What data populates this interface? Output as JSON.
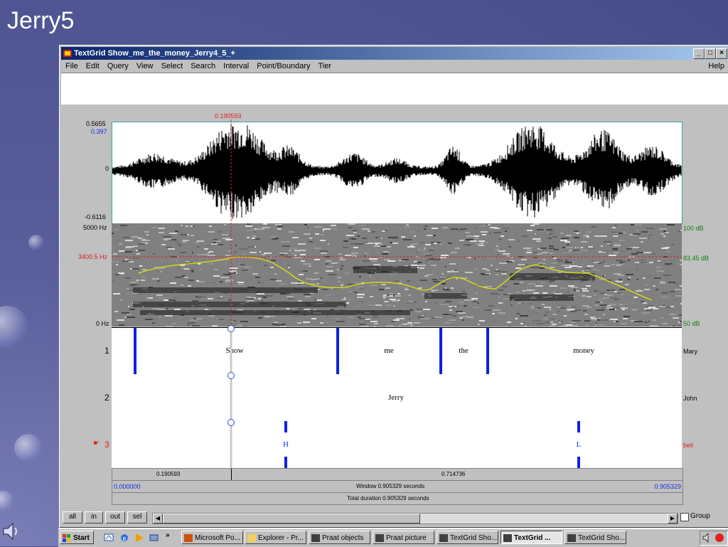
{
  "slide": {
    "title": "Jerry5"
  },
  "window": {
    "title": "TextGrid Show_me_the_money_Jerry4_5_+",
    "controls": {
      "minimize": "_",
      "maximize": "□",
      "close": "×"
    }
  },
  "menu": {
    "items": [
      "File",
      "Edit",
      "Query",
      "View",
      "Select",
      "Search",
      "Interval",
      "Point/Boundary",
      "Tier"
    ],
    "help": "Help"
  },
  "waveform": {
    "cursor_time": "0.190593",
    "y_max": "0.5655",
    "y_cursor": "0.397",
    "y_zero": "0",
    "y_min": "-0.6116"
  },
  "spectrogram": {
    "freq_max": "5000 Hz",
    "freq_cursor": "3400.5 Hz",
    "freq_min": "0 Hz",
    "db_max": "100 dB",
    "db_cursor": "83.45 dB",
    "db_min": "50 dB"
  },
  "tiers": [
    {
      "number": "1",
      "name": "Mary",
      "intervals": [
        "Show",
        "me",
        "the",
        "money"
      ]
    },
    {
      "number": "2",
      "name": "John",
      "intervals": [
        "Jerry"
      ]
    },
    {
      "number": "3",
      "name": "bell",
      "points": [
        "H",
        "L"
      ],
      "selected_marker": "☛"
    }
  ],
  "time_bars": {
    "left_segment": "0.190593",
    "right_segment": "0.714736",
    "start": "0.000000",
    "window": "Window 0.905329 seconds",
    "end": "0.905329",
    "total": "Total duration 0.905329 seconds"
  },
  "buttons": {
    "all": "all",
    "in": "in",
    "out": "out",
    "sel": "sel",
    "group": "Group"
  },
  "taskbar": {
    "start": "Start",
    "chevron": "»",
    "items": [
      {
        "label": "Microsoft Po...",
        "active": false
      },
      {
        "label": "Explorer - Pr...",
        "active": false
      },
      {
        "label": "Praat objects",
        "active": false
      },
      {
        "label": "Praat picture",
        "active": false
      },
      {
        "label": "TextGrid Sho...",
        "active": false
      },
      {
        "label": "TextGrid ...",
        "active": true
      },
      {
        "label": "TextGrid Sho...",
        "active": false
      }
    ]
  },
  "colors": {
    "boundary": "#1020e0",
    "cursor": "#e02020",
    "pitch": "#e8e800",
    "titlebar": "#0a246a"
  },
  "icons": [
    "speaker-icon",
    "praat-icon",
    "minimize-icon",
    "maximize-icon",
    "close-icon",
    "checkbox-icon",
    "volume-icon"
  ]
}
